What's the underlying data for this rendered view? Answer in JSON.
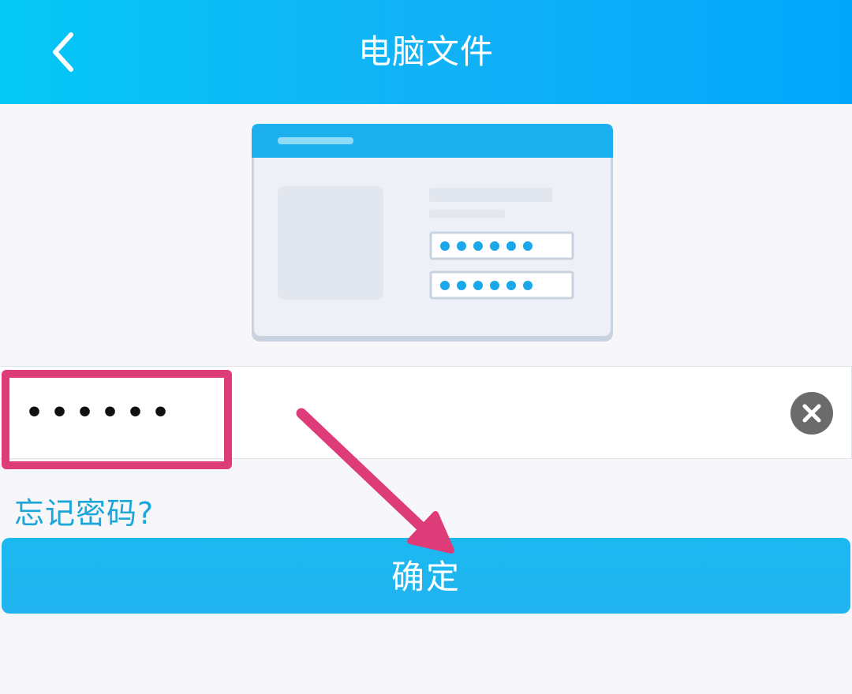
{
  "header": {
    "title": "电脑文件",
    "back_icon": "chevron-left-icon"
  },
  "illustration": {
    "description_icon": "login-window-illustration",
    "field_mask_1": "●●●●●●",
    "field_mask_2": "●●●●●●"
  },
  "password_field": {
    "value": "••••••",
    "clear_icon": "clear-icon"
  },
  "forgot_link": "忘记密码?",
  "confirm_button": "确定",
  "colors": {
    "header_start": "#04c8f6",
    "header_end": "#00a7fb",
    "accent": "#1cb9f1",
    "link": "#1aa6d8",
    "highlight": "#dd3c78"
  }
}
